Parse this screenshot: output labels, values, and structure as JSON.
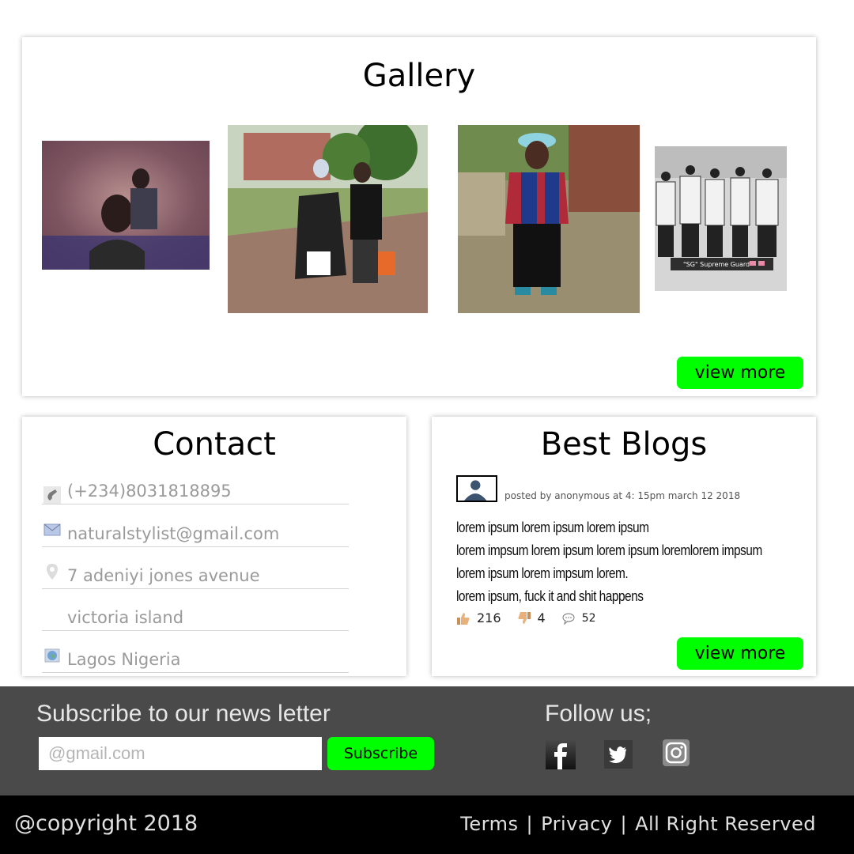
{
  "gallery": {
    "title": "Gallery",
    "view_more_label": "view more",
    "photo4_caption": "\"SG\" Supreme Guard"
  },
  "contact": {
    "title": "Contact",
    "phone": "(+234)8031818895",
    "email": "naturalstylist@gmail.com",
    "address_line1": "7 adeniyi jones avenue",
    "address_line2": "victoria island",
    "location": "Lagos Nigeria"
  },
  "blogs": {
    "title": "Best Blogs",
    "meta": "posted by anonymous at 4: 15pm march 12 2018",
    "lines": [
      "lorem ipsum lorem ipsum lorem ipsum",
      "lorem impsum lorem ipsum lorem ipsum loremlorem impsum",
      "lorem ipsum lorem impsum lorem.",
      "lorem ipsum, fuck it and shit happens"
    ],
    "likes": "216",
    "dislikes": "4",
    "comments": "52",
    "view_more_label": "view more"
  },
  "subscribe": {
    "heading": "Subscribe to our news letter",
    "placeholder": "@gmail.com",
    "button_label": "Subscribe"
  },
  "follow": {
    "heading": "Follow us;",
    "icons": [
      "facebook-icon",
      "twitter-icon",
      "instagram-icon"
    ]
  },
  "footer": {
    "copyright": "@copyright 2018",
    "terms": "Terms",
    "privacy": "Privacy",
    "rights": "All Right Reserved",
    "separator": "|"
  },
  "colors": {
    "accent_green": "#00ff00",
    "subscribe_bar": "#4a4a4a",
    "footer_bar": "#000000"
  }
}
